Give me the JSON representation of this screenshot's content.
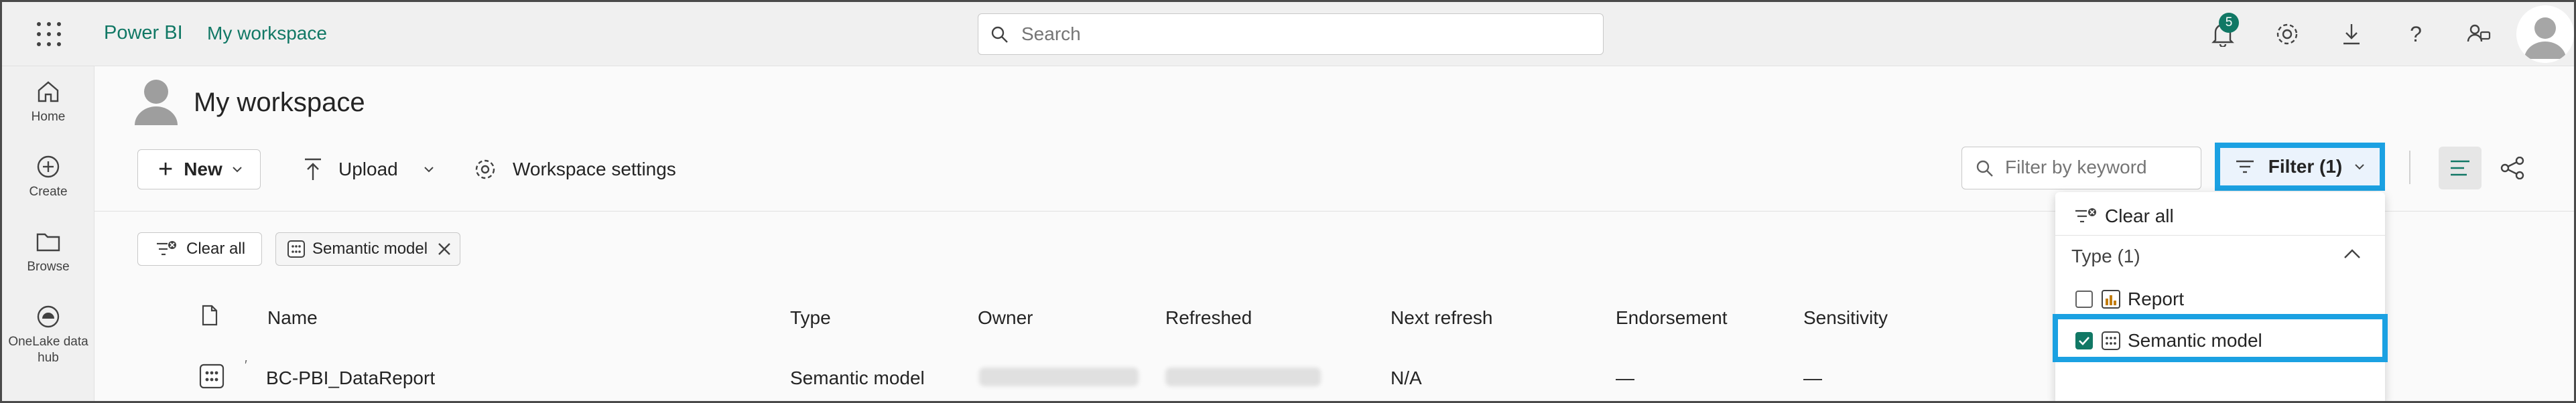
{
  "header": {
    "brand": "Power BI",
    "workspace_link": "My workspace",
    "search_placeholder": "Search",
    "notification_count": "5"
  },
  "rail": {
    "items": [
      {
        "label": "Home"
      },
      {
        "label": "Create"
      },
      {
        "label": "Browse"
      },
      {
        "label": "OneLake data hub"
      }
    ]
  },
  "page": {
    "title": "My workspace"
  },
  "toolbar": {
    "new_label": "New",
    "upload_label": "Upload",
    "workspace_settings_label": "Workspace settings",
    "filter_keyword_placeholder": "Filter by keyword",
    "filter_label": "Filter (1)"
  },
  "chips": {
    "clear_all": "Clear all",
    "active_filter": "Semantic model"
  },
  "table": {
    "columns": [
      "Name",
      "Type",
      "Owner",
      "Refreshed",
      "Next refresh",
      "Endorsement",
      "Sensitivity"
    ],
    "rows": [
      {
        "name": "BC-PBI_DataReport",
        "type": "Semantic model",
        "next_refresh": "N/A",
        "endorsement": "—",
        "sensitivity": "—"
      }
    ]
  },
  "filter_dropdown": {
    "clear_all": "Clear all",
    "group_label": "Type (1)",
    "options": [
      {
        "label": "Report",
        "checked": false
      },
      {
        "label": "Semantic model",
        "checked": true
      }
    ]
  },
  "colors": {
    "accent": "#117865",
    "highlight": "#1ba1e2"
  }
}
